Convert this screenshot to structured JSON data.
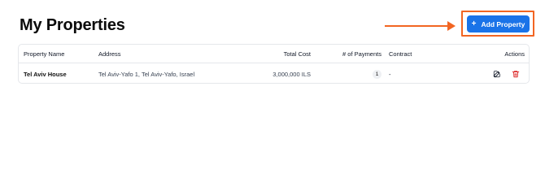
{
  "page": {
    "title": "My Properties"
  },
  "toolbar": {
    "add_label": "Add Property",
    "add_icon": "plus-icon"
  },
  "annotation": {
    "color": "#f26522"
  },
  "table": {
    "columns": [
      "Property Name",
      "Address",
      "Total Cost",
      "# of Payments",
      "Contract",
      "Actions"
    ],
    "rows": [
      {
        "name": "Tel Aviv House",
        "address": "Tel Aviv-Yafo 1, Tel Aviv-Yafo, Israel",
        "total_cost": "3,000,000 ILS",
        "payments": "1",
        "contract": "-",
        "actions": [
          "edit-icon",
          "trash-icon"
        ]
      }
    ]
  },
  "colors": {
    "accent": "#1a73e8",
    "danger": "#dc2626"
  }
}
